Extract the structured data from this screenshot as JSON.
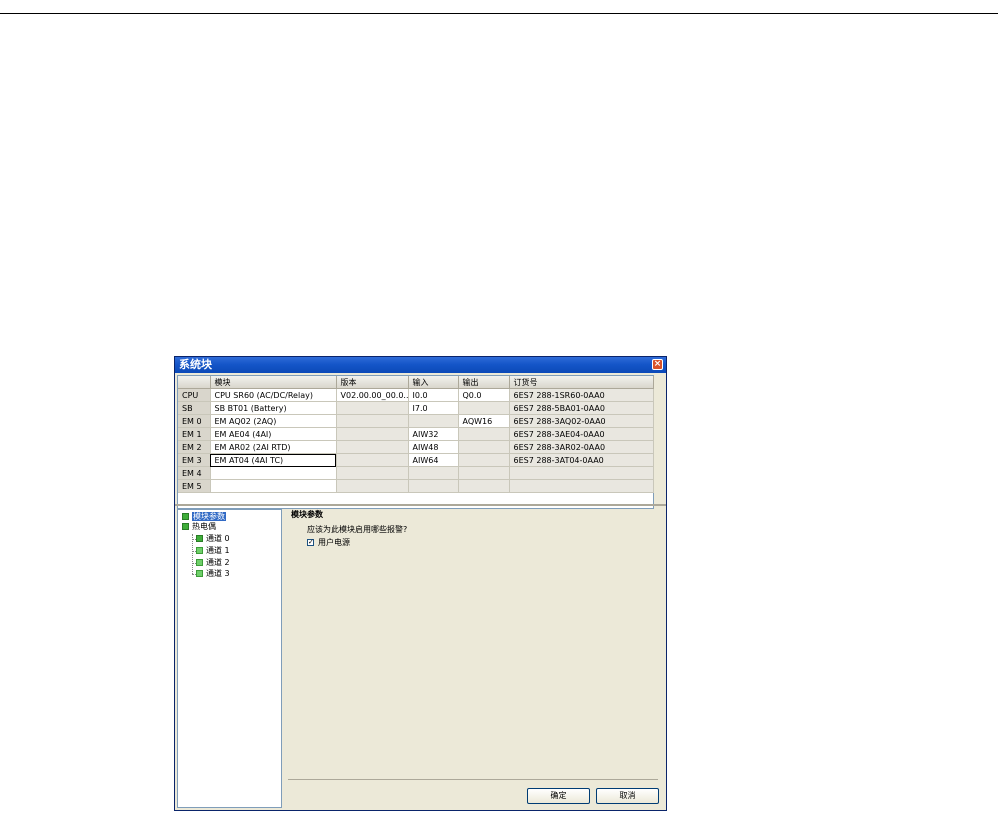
{
  "window": {
    "title": "系统块",
    "close_glyph": "×"
  },
  "grid": {
    "columns": [
      "",
      "模块",
      "版本",
      "输入",
      "输出",
      "订货号"
    ],
    "rows": [
      {
        "slot": "CPU",
        "module": "CPU SR60 (AC/DC/Relay)",
        "version": "V02.00.00_00.0...",
        "input": "I0.0",
        "output": "Q0.0",
        "order": "6ES7 288-1SR60-0AA0"
      },
      {
        "slot": "SB",
        "module": "SB BT01 (Battery)",
        "version": "",
        "input": "I7.0",
        "output": "",
        "order": "6ES7 288-5BA01-0AA0"
      },
      {
        "slot": "EM 0",
        "module": "EM AQ02 (2AQ)",
        "version": "",
        "input": "",
        "output": "AQW16",
        "order": "6ES7 288-3AQ02-0AA0"
      },
      {
        "slot": "EM 1",
        "module": "EM AE04 (4AI)",
        "version": "",
        "input": "AIW32",
        "output": "",
        "order": "6ES7 288-3AE04-0AA0"
      },
      {
        "slot": "EM 2",
        "module": "EM AR02 (2AI RTD)",
        "version": "",
        "input": "AIW48",
        "output": "",
        "order": "6ES7 288-3AR02-0AA0"
      },
      {
        "slot": "EM 3",
        "module": "EM AT04 (4AI TC)",
        "version": "",
        "input": "AIW64",
        "output": "",
        "order": "6ES7 288-3AT04-0AA0"
      },
      {
        "slot": "EM 4",
        "module": "",
        "version": "",
        "input": "",
        "output": "",
        "order": ""
      },
      {
        "slot": "EM 5",
        "module": "",
        "version": "",
        "input": "",
        "output": "",
        "order": ""
      }
    ]
  },
  "tree": {
    "items": [
      {
        "label": "模块参数",
        "selected": true
      },
      {
        "label": "热电偶",
        "selected": false
      },
      {
        "label": "通道 0",
        "selected": false
      },
      {
        "label": "通道 1",
        "selected": false
      },
      {
        "label": "通道 2",
        "selected": false
      },
      {
        "label": "通道 3",
        "selected": false
      }
    ]
  },
  "panel": {
    "title": "模块参数",
    "question": "应该为此模块启用哪些报警?",
    "checkbox_label": "用户电源",
    "checkbox_checked": true,
    "check_glyph": "✓"
  },
  "buttons": {
    "ok": "确定",
    "cancel": "取消"
  }
}
